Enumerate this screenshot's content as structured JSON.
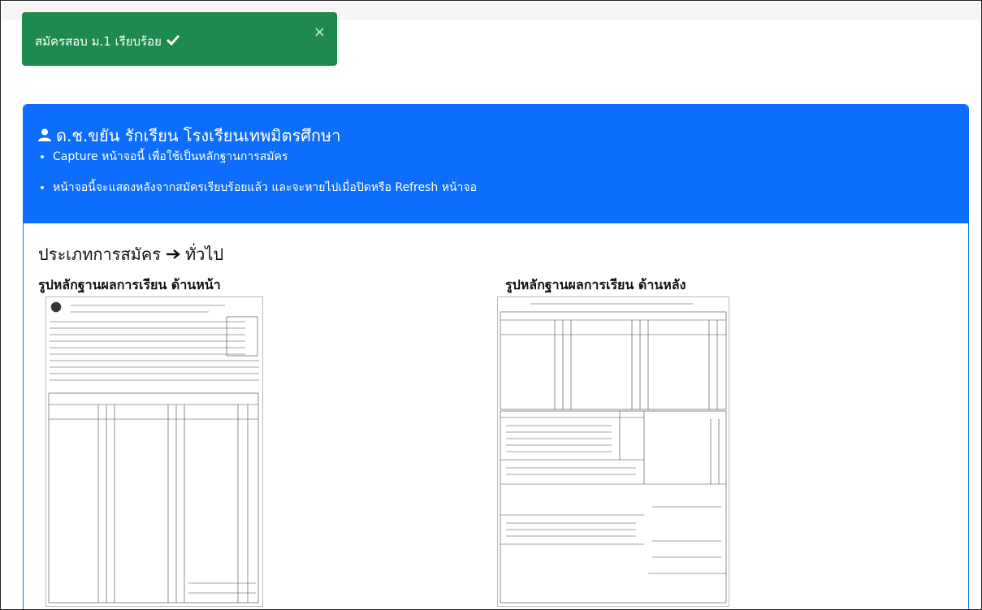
{
  "alert": {
    "message": "สมัครสอบ ม.1 เรียบร้อย",
    "check_icon": "check-icon",
    "close_symbol": "×"
  },
  "card": {
    "title": "ด.ช.ขยัน รักเรียน โรงเรียนเทพมิตรศึกษา",
    "user_icon": "user-icon",
    "notes": [
      "Capture หน้าจอนี้ เพื่อใช้เป็นหลักฐานการสมัคร",
      "หน้าจอนี้จะแสดงหลังจากสมัครเรียบร้อยแล้ว และจะหายไปเมื่อปิดหรือ Refresh หน้าจอ"
    ],
    "accent_color": "#0d6efd"
  },
  "body": {
    "apply_type_label": "ประเภทการสมัคร",
    "apply_type_value": "ทั่วไป",
    "arrow_icon": "arrow-right-icon",
    "front_caption": "รูปหลักฐานผลการเรียน ด้านหน้า",
    "back_caption": "รูปหลักฐานผลการเรียน ด้านหลัง"
  },
  "colors": {
    "success": "#1e8a4d",
    "primary": "#0d6efd"
  }
}
